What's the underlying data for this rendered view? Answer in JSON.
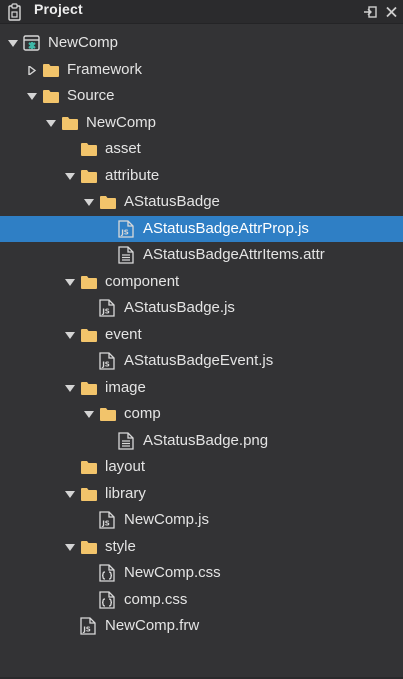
{
  "panel": {
    "title": "Project"
  },
  "tree": [
    {
      "label": "NewComp",
      "depth": 0,
      "expander": "expanded",
      "icon": "project-icon"
    },
    {
      "label": "Framework",
      "depth": 1,
      "expander": "collapsed",
      "icon": "folder-icon"
    },
    {
      "label": "Source",
      "depth": 1,
      "expander": "expanded",
      "icon": "folder-icon"
    },
    {
      "label": "NewComp",
      "depth": 2,
      "expander": "expanded",
      "icon": "folder-icon"
    },
    {
      "label": "asset",
      "depth": 3,
      "expander": "none",
      "icon": "folder-icon"
    },
    {
      "label": "attribute",
      "depth": 3,
      "expander": "expanded",
      "icon": "folder-icon"
    },
    {
      "label": "AStatusBadge",
      "depth": 4,
      "expander": "expanded",
      "icon": "folder-icon"
    },
    {
      "label": "AStatusBadgeAttrProp.js",
      "depth": 5,
      "expander": "none",
      "icon": "js-file-icon",
      "selected": true
    },
    {
      "label": "AStatusBadgeAttrItems.attr",
      "depth": 5,
      "expander": "none",
      "icon": "text-file-icon"
    },
    {
      "label": "component",
      "depth": 3,
      "expander": "expanded",
      "icon": "folder-icon"
    },
    {
      "label": "AStatusBadge.js",
      "depth": 4,
      "expander": "none",
      "icon": "js-file-icon"
    },
    {
      "label": "event",
      "depth": 3,
      "expander": "expanded",
      "icon": "folder-icon"
    },
    {
      "label": "AStatusBadgeEvent.js",
      "depth": 4,
      "expander": "none",
      "icon": "js-file-icon"
    },
    {
      "label": "image",
      "depth": 3,
      "expander": "expanded",
      "icon": "folder-icon"
    },
    {
      "label": "comp",
      "depth": 4,
      "expander": "expanded",
      "icon": "folder-icon"
    },
    {
      "label": "AStatusBadge.png",
      "depth": 5,
      "expander": "none",
      "icon": "text-file-icon"
    },
    {
      "label": "layout",
      "depth": 3,
      "expander": "none",
      "icon": "folder-icon"
    },
    {
      "label": "library",
      "depth": 3,
      "expander": "expanded",
      "icon": "folder-icon"
    },
    {
      "label": "NewComp.js",
      "depth": 4,
      "expander": "none",
      "icon": "js-file-icon"
    },
    {
      "label": "style",
      "depth": 3,
      "expander": "expanded",
      "icon": "folder-icon"
    },
    {
      "label": "NewComp.css",
      "depth": 4,
      "expander": "none",
      "icon": "css-file-icon"
    },
    {
      "label": "comp.css",
      "depth": 4,
      "expander": "none",
      "icon": "css-file-icon"
    },
    {
      "label": "NewComp.frw",
      "depth": 3,
      "expander": "none",
      "icon": "js-file-icon"
    }
  ],
  "colors": {
    "background": "#333335",
    "selection": "#2f7fc5",
    "folder": "#f2c46b",
    "text": "#e4e4e4",
    "file": "#d9d9d9",
    "project": "#3fb7a8"
  }
}
